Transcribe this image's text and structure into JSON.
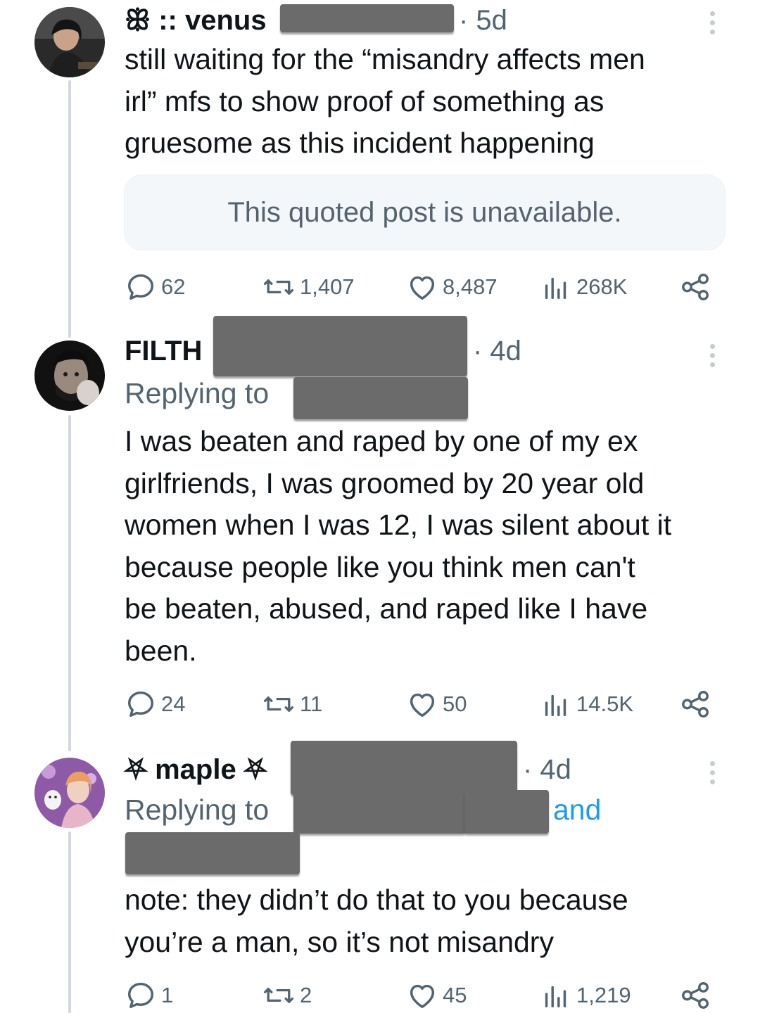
{
  "posts": [
    {
      "name": "ꕥ :: venus",
      "time": "· 5d",
      "body_lines": [
        "still waiting for the “misandry affects men",
        "irl” mfs to show proof of something as",
        "gruesome as this incident happening"
      ],
      "quote": "This quoted post is unavailable.",
      "stats": {
        "replies": "62",
        "reposts": "1,407",
        "likes": "8,487",
        "views": "268K"
      }
    },
    {
      "name": "FILTH",
      "time": "· 4d",
      "replying": "Replying to",
      "body_lines": [
        "I was beaten and raped by one of my ex",
        "girlfriends, I was groomed by 20 year old",
        "women when I was 12, I was silent about it",
        "because people like you think men can't",
        "be beaten, abused, and raped like I have",
        "been."
      ],
      "stats": {
        "replies": "24",
        "reposts": "11",
        "likes": "50",
        "views": "14.5K"
      }
    },
    {
      "name": "⛧ maple ⛧",
      "time": "· 4d",
      "replying": "Replying to",
      "and": "and",
      "body_lines": [
        "note: they didn’t do that to you because",
        "you’re a man, so it’s not misandry"
      ],
      "stats": {
        "replies": "1",
        "reposts": "2",
        "likes": "45",
        "views": "1,219"
      }
    }
  ],
  "icons": [
    "reply-icon",
    "repost-icon",
    "like-icon",
    "views-icon",
    "share-icon",
    "more-icon"
  ],
  "colors": {
    "text": "#0f1419",
    "secondary": "#536471",
    "link": "#1d9bf0",
    "thread_line": "#cfd9de",
    "redaction": "#6b6b6b"
  }
}
